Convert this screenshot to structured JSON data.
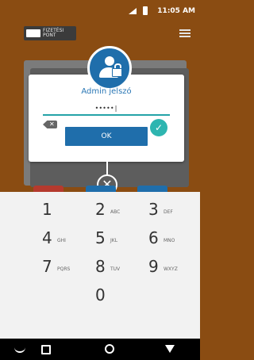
{
  "status_bar": {
    "time": "11:05 AM"
  },
  "app": {
    "logo_text": "FIZETÉSI\nPONT"
  },
  "dialog": {
    "title": "Admin jelszó",
    "password_value": "•••••|",
    "ok_label": "OK"
  },
  "keypad": {
    "keys": [
      {
        "number": "1",
        "letters": ""
      },
      {
        "number": "2",
        "letters": "ABC"
      },
      {
        "number": "3",
        "letters": "DEF"
      },
      {
        "number": "4",
        "letters": "GHI"
      },
      {
        "number": "5",
        "letters": "JKL"
      },
      {
        "number": "6",
        "letters": "MNO"
      },
      {
        "number": "7",
        "letters": "PQRS"
      },
      {
        "number": "8",
        "letters": "TUV"
      },
      {
        "number": "9",
        "letters": "WXYZ"
      },
      {
        "number": "0",
        "letters": ""
      }
    ],
    "delete_icon": "backspace-icon",
    "confirm_icon": "check-icon"
  },
  "colors": {
    "app_bg": "#8a4c12",
    "accent_blue": "#1f6eab",
    "teal": "#2eb5b0"
  }
}
